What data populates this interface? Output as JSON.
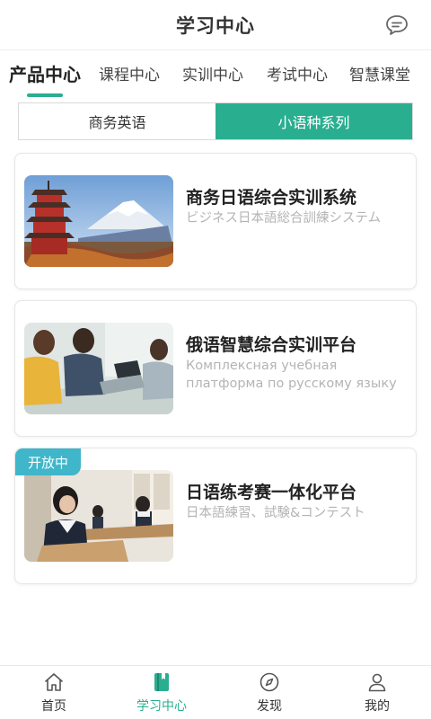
{
  "header": {
    "title": "学习中心",
    "icon": "message-icon"
  },
  "tabs": [
    {
      "label": "产品中心",
      "active": true
    },
    {
      "label": "课程中心",
      "active": false
    },
    {
      "label": "实训中心",
      "active": false
    },
    {
      "label": "考试中心",
      "active": false
    },
    {
      "label": "智慧课堂",
      "active": false
    }
  ],
  "segment": [
    {
      "label": "商务英语",
      "active": false
    },
    {
      "label": "小语种系列",
      "active": true
    }
  ],
  "cards": [
    {
      "title": "商务日语综合实训系统",
      "subtitle": "ビジネス日本語総合訓練システム",
      "badge": ""
    },
    {
      "title": "俄语智慧综合实训平台",
      "subtitle": "Комплексная учебная платформа по русскому языку",
      "badge": ""
    },
    {
      "title": "日语练考赛一体化平台",
      "subtitle": "日本語練習、試験&コンテスト",
      "badge": "开放中"
    }
  ],
  "bottom_nav": [
    {
      "label": "首页",
      "icon": "home-icon",
      "active": false
    },
    {
      "label": "学习中心",
      "icon": "book-icon",
      "active": true
    },
    {
      "label": "发现",
      "icon": "compass-icon",
      "active": false
    },
    {
      "label": "我的",
      "icon": "user-icon",
      "active": false
    }
  ],
  "colors": {
    "accent": "#2aae90",
    "badge": "#3fb6c9"
  }
}
